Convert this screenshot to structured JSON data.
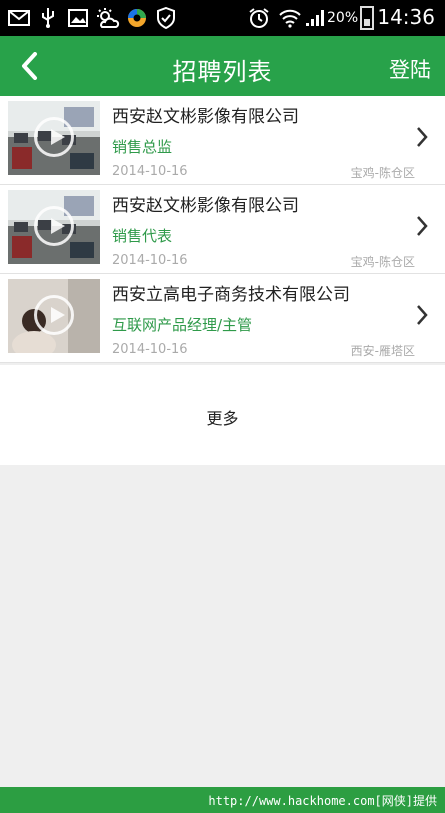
{
  "status_bar": {
    "battery_pct": "20%",
    "time": "14:36"
  },
  "app_bar": {
    "title": "招聘列表",
    "login_label": "登陆"
  },
  "jobs": [
    {
      "company": "西安赵文彬影像有限公司",
      "position": "销售总监",
      "date": "2014-10-16",
      "location": "宝鸡-陈仓区"
    },
    {
      "company": "西安赵文彬影像有限公司",
      "position": "销售代表",
      "date": "2014-10-16",
      "location": "宝鸡-陈仓区"
    },
    {
      "company": "西安立高电子商务技术有限公司",
      "position": "互联网产品经理/主管",
      "date": "2014-10-16",
      "location": "西安-雁塔区"
    }
  ],
  "more_label": "更多",
  "footer": {
    "text": "http://www.hackhome.com[网侠]提供"
  },
  "colors": {
    "accent": "#28a24a",
    "position_text": "#2f9a4a"
  }
}
